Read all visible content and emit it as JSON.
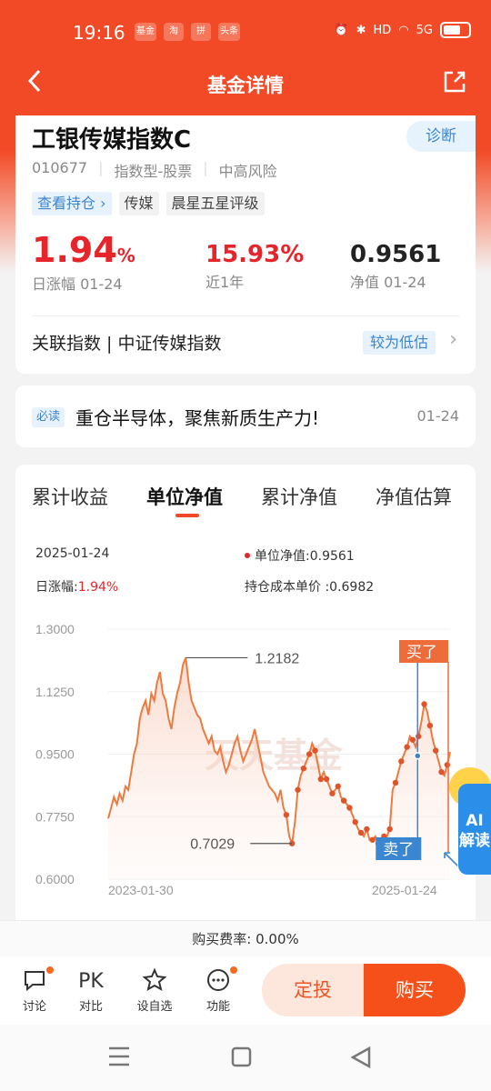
{
  "status": {
    "time": "19:16",
    "apps": [
      "基金",
      "淘",
      "拼",
      "头条"
    ],
    "icons": [
      "dot",
      "alarm-icon",
      "bluetooth-icon",
      "hd-icon",
      "wifi-icon",
      "5g-signal-icon",
      "battery-icon"
    ],
    "hd": "HD",
    "net": "5G"
  },
  "nav": {
    "title": "基金详情",
    "back_icon": "chevron-left",
    "share_icon": "share-out"
  },
  "fund": {
    "name": "工银传媒指数C",
    "diagnose_label": "诊断",
    "code": "010677",
    "type": "指数型-股票",
    "risk": "中高风险",
    "tags": [
      "查看持仓 ›",
      "传媒",
      "晨星五星评级"
    ],
    "day_change_value": "1.94",
    "day_change_unit": "%",
    "day_change_label": "日涨幅 01-24",
    "year_change_value": "15.93%",
    "year_change_label": "近1年",
    "nav_value": "0.9561",
    "nav_label": "净值 01-24",
    "index_text": "关联指数 | 中证传媒指数",
    "index_badge": "较为低估"
  },
  "news": {
    "badge": "必读",
    "text": "重仓半导体，聚焦新质生产力!",
    "date": "01-24"
  },
  "tabs": [
    "累计收益",
    "单位净值",
    "累计净值",
    "净值估算"
  ],
  "active_tab": 1,
  "chart_info": {
    "date": "2025-01-24",
    "nav_label": "单位净值:",
    "nav_value": "0.9561",
    "change_label": "日涨幅:",
    "change_value": "1.94%",
    "cost_label": "持仓成本单价",
    "cost_value": ":0.6982"
  },
  "chart_data": {
    "type": "line",
    "yticks": [
      "1.3000",
      "1.1250",
      "0.9500",
      "0.7750",
      "0.6000"
    ],
    "ylim": [
      0.6,
      1.3
    ],
    "xlabels": [
      "2023-01-30",
      "2025-01-24"
    ],
    "watermark": "天天基金",
    "max_label": "1.2182",
    "min_label": "0.7029",
    "buy_label": "买了",
    "sell_label": "卖了",
    "series": [
      {
        "values": [
          0.77,
          0.8,
          0.83,
          0.81,
          0.84,
          0.82,
          0.86,
          0.85,
          0.9,
          0.95,
          0.98,
          1.05,
          1.08,
          1.1,
          1.06,
          1.12,
          1.1,
          1.15,
          1.18,
          1.12,
          1.1,
          1.05,
          1.02,
          1.08,
          1.12,
          1.15,
          1.2,
          1.22,
          1.15,
          1.1,
          1.08,
          1.06,
          1.05,
          1.02,
          1.0,
          0.98,
          1.0,
          0.96,
          0.95,
          0.97,
          0.93,
          0.9,
          0.92,
          0.95,
          0.98,
          1.0,
          0.96,
          0.93,
          0.95,
          0.97,
          0.99,
          1.02,
          0.98,
          0.94,
          0.9,
          0.88,
          0.86,
          0.85,
          0.84,
          0.82,
          0.85,
          0.8,
          0.78,
          0.72,
          0.7,
          0.76,
          0.85,
          0.89,
          0.91,
          0.93,
          0.95,
          0.98,
          0.96,
          0.92,
          0.88,
          0.9,
          0.88,
          0.86,
          0.84,
          0.85,
          0.86,
          0.83,
          0.82,
          0.81,
          0.8,
          0.78,
          0.76,
          0.74,
          0.73,
          0.72,
          0.74,
          0.71,
          0.71,
          0.72,
          0.7,
          0.71,
          0.72,
          0.72,
          0.74,
          0.85,
          0.87,
          0.9,
          0.93,
          0.95,
          0.97,
          1.0,
          0.99,
          0.97,
          1.0,
          1.04,
          1.09,
          1.07,
          1.03,
          0.99,
          0.96,
          0.93,
          0.9,
          0.89,
          0.92,
          0.9561
        ]
      }
    ]
  },
  "bottom": {
    "fee_label": "购买费率:",
    "fee_value": "0.00%",
    "actions": [
      {
        "label": "讨论",
        "icon": "chat-icon"
      },
      {
        "label": "对比",
        "icon": "pk-icon",
        "glyph": "PK"
      },
      {
        "label": "设自选",
        "icon": "star-add-icon"
      },
      {
        "label": "功能",
        "icon": "more-icon"
      }
    ],
    "dingtou": "定投",
    "buy": "购买"
  },
  "ai_label": "AI解读",
  "colors": {
    "brand": "#f24a26",
    "up": "#e6242a",
    "line": "#ee7a3e",
    "blue": "#3b86d1",
    "buy_btn": "#f6501a"
  }
}
